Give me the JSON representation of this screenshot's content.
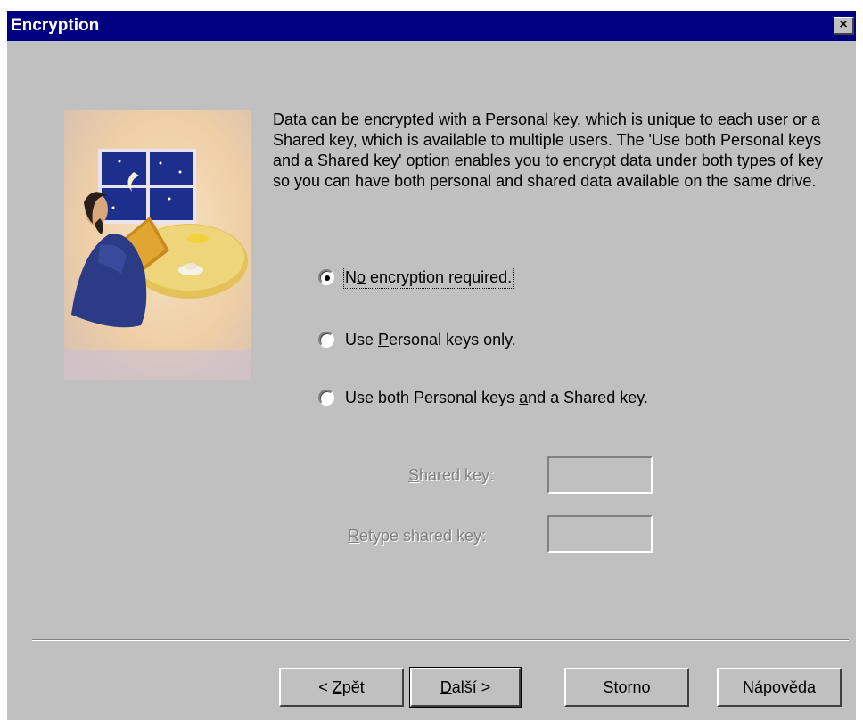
{
  "window": {
    "title": "Encryption",
    "close_glyph": "×"
  },
  "description": "Data can be encrypted with a Personal key, which is unique to each user or a Shared key, which is available to multiple users. The 'Use both Personal keys and a Shared key' option enables you to encrypt data under both types of key so you can have both personal and shared data available on the same drive.",
  "options": [
    {
      "before": "N",
      "mnemonic": "o",
      "after": " encryption required.",
      "selected": true
    },
    {
      "before": "Use ",
      "mnemonic": "P",
      "after": "ersonal keys only.",
      "selected": false
    },
    {
      "before": "Use both Personal keys ",
      "mnemonic": "a",
      "after": "nd a Shared key.",
      "selected": false
    }
  ],
  "fields": {
    "shared_key": {
      "mnemonic": "S",
      "rest": "hared key:",
      "value": ""
    },
    "retype_key": {
      "mnemonic": "R",
      "rest": "etype shared key:",
      "value": ""
    }
  },
  "buttons": {
    "back": {
      "prefix": "< ",
      "mnemonic": "Z",
      "rest": "pět"
    },
    "next": {
      "prefix": "",
      "mnemonic": "D",
      "rest": "alší >"
    },
    "cancel": {
      "label": "Storno"
    },
    "help": {
      "label": "Nápověda"
    }
  },
  "colors": {
    "title_bar": "#000080",
    "dialog_bg": "#c0c0c0",
    "disabled_text": "#808080"
  }
}
